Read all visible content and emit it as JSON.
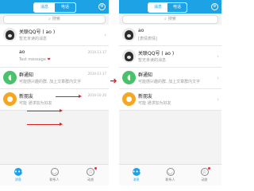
{
  "left": {
    "tabs": [
      "消息",
      "电话"
    ],
    "search_placeholder": "搜索",
    "items": [
      {
        "avatar": "photo",
        "name": "关联QQ号 ( ao )",
        "sub": "暂无未读的消息",
        "time": ""
      },
      {
        "avatar": "empty",
        "name": "ao",
        "sub": "Test message",
        "time": "2014-11-17"
      },
      {
        "avatar": "speaker",
        "name": "群通知",
        "sub": "可能感兴趣的群, 加上文章群内文字",
        "time": "2014-11-17"
      },
      {
        "avatar": "person",
        "name": "新朋友",
        "sub": "可能 通求加为好友",
        "time": "2014-10-30"
      }
    ],
    "bottom_tabs": [
      "消息",
      "联系人",
      "动态"
    ]
  },
  "right": {
    "tabs": [
      "消息",
      "电话"
    ],
    "search_placeholder": "搜索",
    "items": [
      {
        "avatar": "photo",
        "name": "ao",
        "sub": "[表情表情]",
        "time": ""
      },
      {
        "avatar": "photo",
        "name": "关联QQ号 ( ao )",
        "sub": "暂无未读的消息",
        "time": ""
      },
      {
        "avatar": "speaker",
        "name": "群通知",
        "sub": "可能感兴趣的群, 加上文章群内文字",
        "time": ""
      },
      {
        "avatar": "person",
        "name": "新朋友",
        "sub": "可能 通求加为好友",
        "time": ""
      }
    ],
    "bottom_tabs": [
      "消息",
      "联系人",
      "动态"
    ]
  },
  "icons": {
    "settings": "gear-icon",
    "search": "search-icon",
    "group_notice": "speaker-icon",
    "new_friend": "person-icon",
    "transition": "right-arrow-icon"
  },
  "colors": {
    "accent": "#1da2e6",
    "group_notice": "#4cc06a",
    "new_friend": "#f5a623",
    "annotation": "#e02020"
  }
}
